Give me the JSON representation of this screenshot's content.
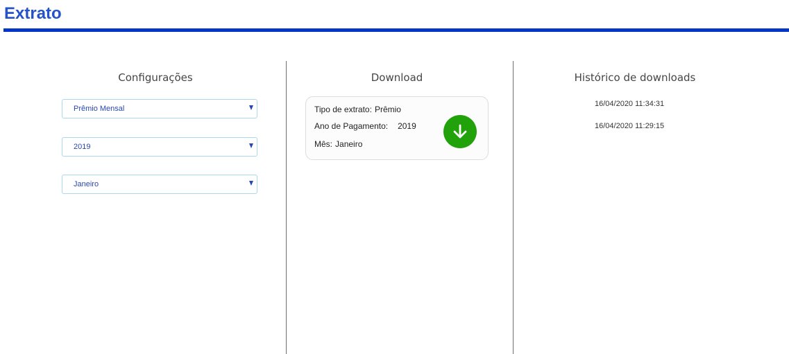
{
  "page": {
    "title": "Extrato"
  },
  "config": {
    "heading": "Configurações",
    "selects": [
      {
        "value": "Prêmio Mensal"
      },
      {
        "value": "2019"
      },
      {
        "value": "Janeiro"
      }
    ]
  },
  "download": {
    "heading": "Download",
    "card": {
      "tipo_label": "Tipo de extrato:",
      "tipo_value": "Prêmio",
      "ano_label": "Ano de Pagamento:",
      "ano_value": "2019",
      "mes_label": "Mês:",
      "mes_value": "Janeiro"
    },
    "button_icon": "arrow-down-icon"
  },
  "history": {
    "heading": "Histórico de downloads",
    "items": [
      "16/04/2020 11:34:31",
      "16/04/2020 11:29:15"
    ]
  },
  "colors": {
    "accent": "#0035cc",
    "title": "#2453c9",
    "download_button": "#22a20a",
    "select_border": "#a9d8ef"
  }
}
